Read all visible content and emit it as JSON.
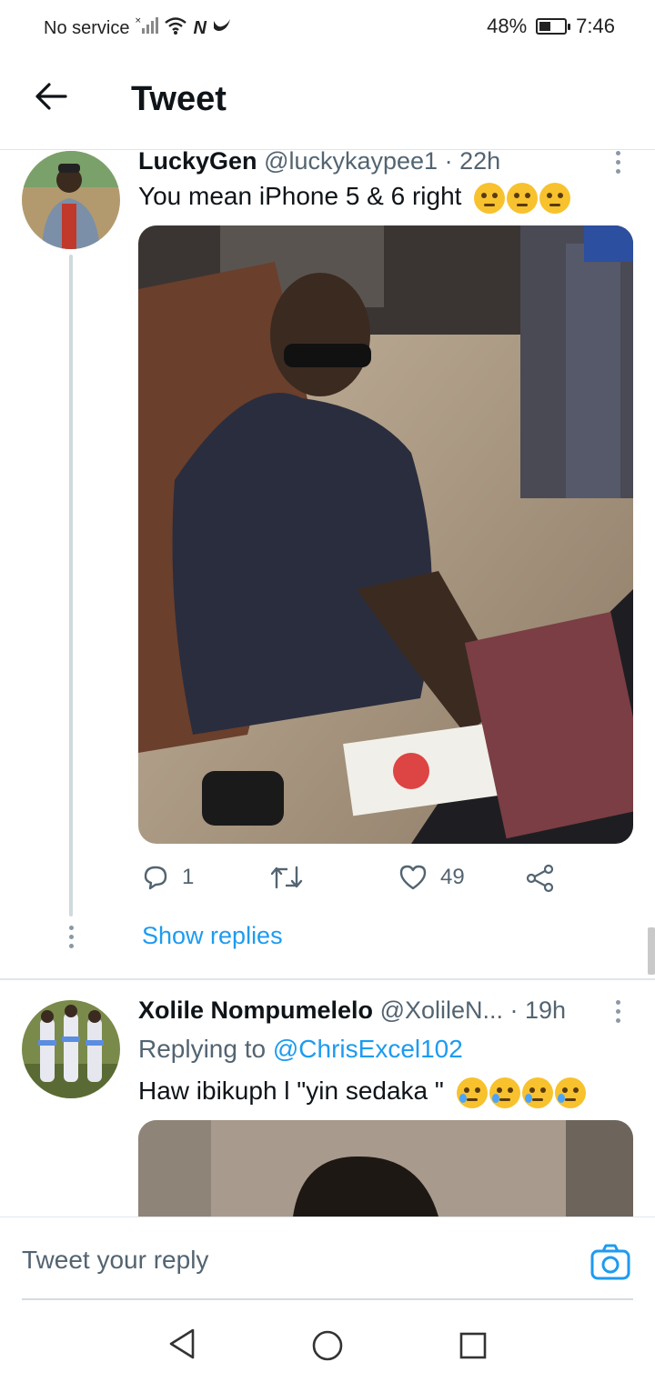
{
  "status_bar": {
    "carrier": "No service",
    "battery": "48%",
    "battery_level": 0.48,
    "time": "7:46",
    "icons": [
      "no-signal-icon",
      "wifi-icon",
      "nfc-icon",
      "bluetooth-icon",
      "battery-icon"
    ]
  },
  "header": {
    "title": "Tweet",
    "back_icon": "back-arrow-icon"
  },
  "tweets": [
    {
      "display_name": "LuckyGen",
      "handle": "@luckykaypee1",
      "time": "· 22h",
      "text": "You mean iPhone 5 & 6 right",
      "emoji": [
        "thinking-face",
        "thinking-face",
        "thinking-face"
      ],
      "replies": "1",
      "likes": "49",
      "show_replies": "Show replies"
    },
    {
      "display_name": "Xolile Nompumelelo",
      "handle": "@XolileN...",
      "time": "· 19h",
      "replying_prefix": "Replying to",
      "replying_to": "@ChrisExcel102",
      "text": "Haw ibikuph l \"yin sedaka \"",
      "emoji": [
        "sleepy-face",
        "sleepy-face",
        "sleepy-face",
        "sleepy-face"
      ]
    }
  ],
  "reply_bar": {
    "placeholder": "Tweet your reply"
  },
  "colors": {
    "accent": "#1d9bf0",
    "text": "#0f1419",
    "muted": "#536471"
  }
}
